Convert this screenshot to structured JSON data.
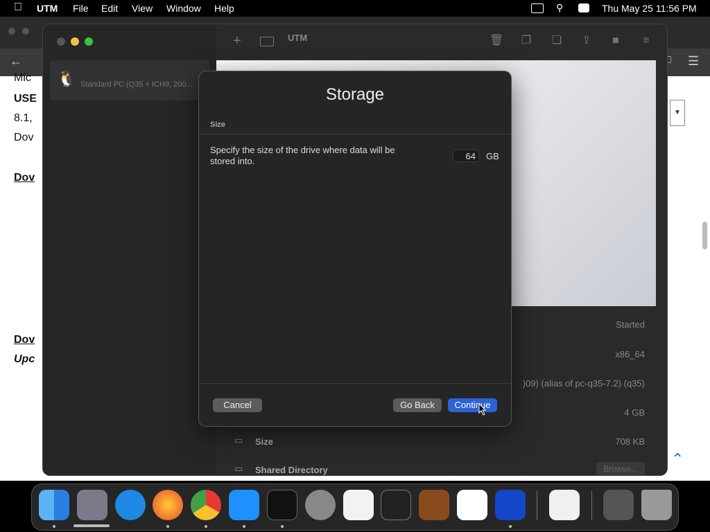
{
  "menubar": {
    "app_name": "UTM",
    "items": [
      "File",
      "Edit",
      "View",
      "Window",
      "Help"
    ],
    "clock": "Thu May 25  11:56 PM"
  },
  "background_page": {
    "lines": [
      "Mic",
      "USE",
      "8.1,",
      "Dov",
      "Dov",
      "Dov",
      "Upc"
    ]
  },
  "utm": {
    "title": "UTM",
    "vm_name": "Standard PC (Q35 + ICH9, 200...",
    "info": {
      "status": "Started",
      "arch": "x86_64",
      "machine": ")09) (alias of pc-q35-7.2) (q35)",
      "memory": "4 GB",
      "size_label": "Size",
      "size_value": "708 KB",
      "shared_label": "Shared Directory",
      "browse_label": "Browse..."
    }
  },
  "sheet": {
    "title": "Storage",
    "section": "Size",
    "description": "Specify the size of the drive where data will be stored into.",
    "size_value": "64",
    "unit": "GB",
    "cancel": "Cancel",
    "go_back": "Go Back",
    "continue": "Continue"
  },
  "dock": {
    "apps": [
      "finder-icon",
      "launchpad-icon",
      "safari-icon",
      "firefox-icon",
      "chrome-icon",
      "app-store-icon",
      "terminal-icon",
      "system-settings-icon",
      "textedit-icon",
      "iterm-icon",
      "garageband-icon",
      "vscode-icon",
      "utm-icon",
      "visual-studio-icon",
      "downloads-stack-icon",
      "trash-icon"
    ]
  }
}
